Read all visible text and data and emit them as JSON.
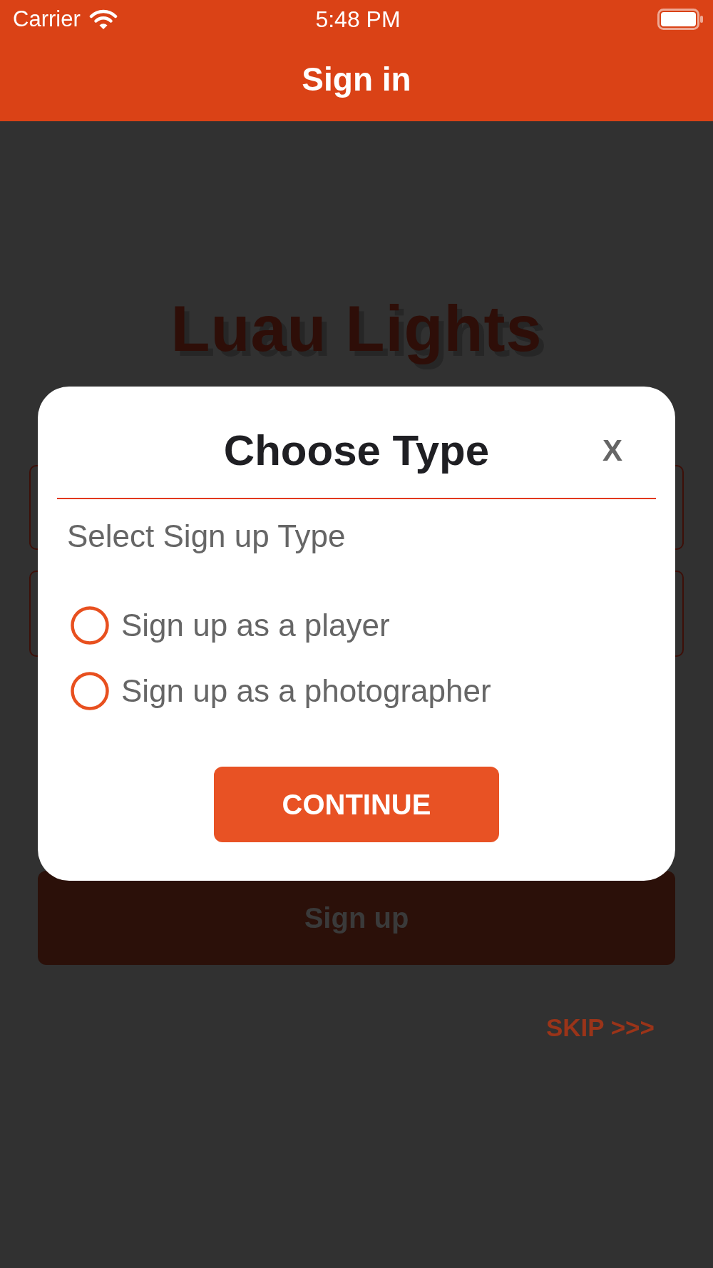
{
  "status_bar": {
    "carrier": "Carrier",
    "time": "5:48 PM"
  },
  "nav_bar": {
    "title": "Sign in"
  },
  "background": {
    "logo": "Luau Lights",
    "sign_up_button": "Sign up",
    "skip_link": "SKIP >>>"
  },
  "dialog": {
    "title": "Choose Type",
    "close": "X",
    "prompt": "Select Sign up Type",
    "options": [
      {
        "label": "Sign up as a player",
        "selected": false
      },
      {
        "label": "Sign up as a photographer",
        "selected": false
      }
    ],
    "button": "CONTINUE"
  }
}
